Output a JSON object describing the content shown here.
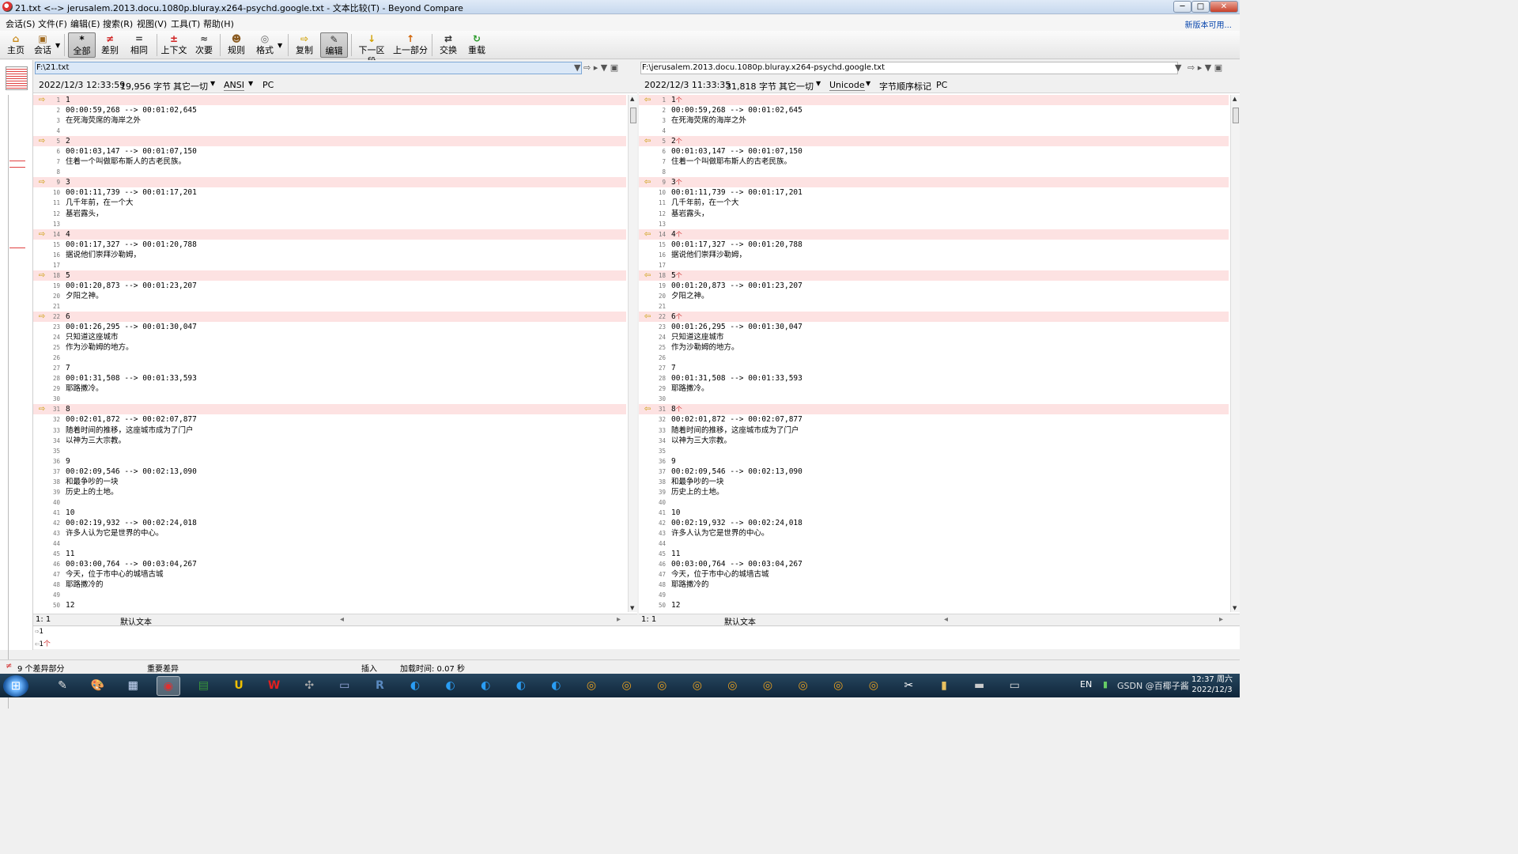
{
  "window": {
    "title": "21.txt <--> jerusalem.2013.docu.1080p.bluray.x264-psychd.google.txt - 文本比较(T) - Beyond Compare",
    "tagline": "",
    "controls": {
      "min": "─",
      "max": "□",
      "close": "✕"
    }
  },
  "menu": {
    "items": [
      "会话(S)",
      "文件(F)",
      "编辑(E)",
      "搜索(R)",
      "视图(V)",
      "工具(T)",
      "帮助(H)"
    ],
    "update_link": "新版本可用..."
  },
  "toolbar": {
    "buttons": [
      {
        "label": "主页",
        "icon": "home-icon",
        "glyph": "⌂",
        "color": "#c98a1a"
      },
      {
        "label": "会话",
        "icon": "session-icon",
        "glyph": "▣",
        "color": "#a06a20"
      },
      {
        "label": "全部",
        "icon": "all-icon",
        "glyph": "*",
        "color": "#222"
      },
      {
        "label": "差别",
        "icon": "diff-icon",
        "glyph": "≠",
        "color": "#d02020"
      },
      {
        "label": "相同",
        "icon": "same-icon",
        "glyph": "=",
        "color": "#444"
      },
      {
        "label": "上下文",
        "icon": "context-icon",
        "glyph": "±",
        "color": "#d02020"
      },
      {
        "label": "次要",
        "icon": "minor-icon",
        "glyph": "≈",
        "color": "#444"
      },
      {
        "label": "规则",
        "icon": "rules-icon",
        "glyph": "☻",
        "color": "#8a5a20"
      },
      {
        "label": "格式",
        "icon": "format-icon",
        "glyph": "◎",
        "color": "#666"
      },
      {
        "label": "复制",
        "icon": "copy-icon",
        "glyph": "⇨",
        "color": "#d0a000"
      },
      {
        "label": "编辑",
        "icon": "edit-icon",
        "glyph": "✎",
        "color": "#333"
      },
      {
        "label": "下一区段",
        "icon": "next-section-icon",
        "glyph": "↓",
        "color": "#d0a000"
      },
      {
        "label": "上一部分",
        "icon": "prev-section-icon",
        "glyph": "↑",
        "color": "#d06000"
      },
      {
        "label": "交换",
        "icon": "swap-icon",
        "glyph": "⇄",
        "color": "#333"
      },
      {
        "label": "重载",
        "icon": "reload-icon",
        "glyph": "↻",
        "color": "#2a9a2a"
      }
    ]
  },
  "left": {
    "path": "F:\\21.txt",
    "date": "2022/12/3 12:33:59",
    "size": "19,956 字节",
    "other": "其它一切",
    "encoding": "ANSI",
    "bom": "",
    "lineend": "PC",
    "pos": "1: 1",
    "mode": "默认文本"
  },
  "right": {
    "path": "F:\\jerusalem.2013.docu.1080p.bluray.x264-psychd.google.txt",
    "date": "2022/12/3 11:33:35",
    "size": "31,818 字节",
    "other": "其它一切",
    "encoding": "Unicode",
    "bom": "字节顺序标记",
    "lineend": "PC",
    "pos": "1: 1",
    "mode": "默认文本"
  },
  "lines": [
    {
      "n": "1",
      "t": "1",
      "d": true
    },
    {
      "n": "2",
      "t": "00:00:59,268 --> 00:01:02,645",
      "d": false
    },
    {
      "n": "3",
      "t": "在死海荧席的海岸之外",
      "d": false
    },
    {
      "n": "4",
      "t": "",
      "d": false
    },
    {
      "n": "5",
      "t": "2",
      "d": true
    },
    {
      "n": "6",
      "t": "00:01:03,147 --> 00:01:07,150",
      "d": false
    },
    {
      "n": "7",
      "t": "住着一个叫做耶布斯人的古老民族。",
      "d": false
    },
    {
      "n": "8",
      "t": "",
      "d": false
    },
    {
      "n": "9",
      "t": "3",
      "d": true
    },
    {
      "n": "10",
      "t": "00:01:11,739 --> 00:01:17,201",
      "d": false
    },
    {
      "n": "11",
      "t": "几千年前，在一个大",
      "d": false
    },
    {
      "n": "12",
      "t": "基岩露头，",
      "d": false
    },
    {
      "n": "13",
      "t": "",
      "d": false
    },
    {
      "n": "14",
      "t": "4",
      "d": true
    },
    {
      "n": "15",
      "t": "00:01:17,327 --> 00:01:20,788",
      "d": false
    },
    {
      "n": "16",
      "t": "据说他们崇拜沙勒姆，",
      "d": false
    },
    {
      "n": "17",
      "t": "",
      "d": false
    },
    {
      "n": "18",
      "t": "5",
      "d": true
    },
    {
      "n": "19",
      "t": "00:01:20,873 --> 00:01:23,207",
      "d": false
    },
    {
      "n": "20",
      "t": "夕阳之神。",
      "d": false
    },
    {
      "n": "21",
      "t": "",
      "d": false
    },
    {
      "n": "22",
      "t": "6",
      "d": true
    },
    {
      "n": "23",
      "t": "00:01:26,295 --> 00:01:30,047",
      "d": false
    },
    {
      "n": "24",
      "t": "只知道这座城市",
      "d": false
    },
    {
      "n": "25",
      "t": "作为沙勒姆的地方。",
      "d": false
    },
    {
      "n": "26",
      "t": "",
      "d": false
    },
    {
      "n": "27",
      "t": "7",
      "d": false
    },
    {
      "n": "28",
      "t": "00:01:31,508 --> 00:01:33,593",
      "d": false
    },
    {
      "n": "29",
      "t": "耶路撒冷。",
      "d": false
    },
    {
      "n": "30",
      "t": "",
      "d": false
    },
    {
      "n": "31",
      "t": "8",
      "d": true
    },
    {
      "n": "32",
      "t": "00:02:01,872 --> 00:02:07,877",
      "d": false
    },
    {
      "n": "33",
      "t": "随着时间的推移，这座城市成为了门户",
      "d": false
    },
    {
      "n": "34",
      "t": "以神为三大宗教。",
      "d": false
    },
    {
      "n": "35",
      "t": "",
      "d": false
    },
    {
      "n": "36",
      "t": "9",
      "d": false
    },
    {
      "n": "37",
      "t": "00:02:09,546 --> 00:02:13,090",
      "d": false
    },
    {
      "n": "38",
      "t": "和最争吵的一块",
      "d": false
    },
    {
      "n": "39",
      "t": "历史上的土地。",
      "d": false
    },
    {
      "n": "40",
      "t": "",
      "d": false
    },
    {
      "n": "41",
      "t": "10",
      "d": false
    },
    {
      "n": "42",
      "t": "00:02:19,932 --> 00:02:24,018",
      "d": false
    },
    {
      "n": "43",
      "t": "许多人认为它是世界的中心。",
      "d": false
    },
    {
      "n": "44",
      "t": "",
      "d": false
    },
    {
      "n": "45",
      "t": "11",
      "d": false
    },
    {
      "n": "46",
      "t": "00:03:00,764 --> 00:03:04,267",
      "d": false
    },
    {
      "n": "47",
      "t": "今天，位于市中心的城墙古城",
      "d": false
    },
    {
      "n": "48",
      "t": "耶路撒冷的",
      "d": false
    },
    {
      "n": "49",
      "t": "",
      "d": false
    },
    {
      "n": "50",
      "t": "12",
      "d": false
    }
  ],
  "diff_marker": "个",
  "compare": {
    "left_line": "1",
    "right_line": "1",
    "right_mark": "个"
  },
  "status": {
    "diff_count": "9 个差异部分",
    "important": "重要差异",
    "insert": "插入",
    "load_time": "加载时间: 0.07 秒"
  },
  "taskbar": {
    "start": "⊞",
    "items": [
      {
        "icon": "pen-icon",
        "glyph": "✎",
        "color": "#e0e0e0"
      },
      {
        "icon": "paint-icon",
        "glyph": "🎨",
        "color": "#f0c060"
      },
      {
        "icon": "calculator-icon",
        "glyph": "▦",
        "color": "#cfe0ff"
      },
      {
        "icon": "beyond-compare-icon",
        "glyph": "◉",
        "color": "#e03030",
        "active": true
      },
      {
        "icon": "table-icon",
        "glyph": "▤",
        "color": "#3a9a3a"
      },
      {
        "icon": "ultraedit-icon",
        "glyph": "U",
        "color": "#f0c000"
      },
      {
        "icon": "wps-icon",
        "glyph": "W",
        "color": "#e02020"
      },
      {
        "icon": "tool-icon",
        "glyph": "✣",
        "color": "#aaa"
      },
      {
        "icon": "notepad-icon",
        "glyph": "▭",
        "color": "#9ad"
      },
      {
        "icon": "r-icon",
        "glyph": "R",
        "color": "#5a8ac0"
      },
      {
        "icon": "edge-icon",
        "glyph": "◐",
        "color": "#2a9df4"
      },
      {
        "icon": "edge-icon",
        "glyph": "◐",
        "color": "#2a9df4"
      },
      {
        "icon": "edge-icon",
        "glyph": "◐",
        "color": "#2a9df4"
      },
      {
        "icon": "edge-icon",
        "glyph": "◐",
        "color": "#2a9df4"
      },
      {
        "icon": "edge-icon",
        "glyph": "◐",
        "color": "#2a9df4"
      },
      {
        "icon": "chrome-icon",
        "glyph": "◎",
        "color": "#e8a020"
      },
      {
        "icon": "chrome-icon",
        "glyph": "◎",
        "color": "#e8a020"
      },
      {
        "icon": "chrome-icon",
        "glyph": "◎",
        "color": "#e8a020"
      },
      {
        "icon": "chrome-icon",
        "glyph": "◎",
        "color": "#e8a020"
      },
      {
        "icon": "chrome-icon",
        "glyph": "◎",
        "color": "#e8a020"
      },
      {
        "icon": "chrome-icon",
        "glyph": "◎",
        "color": "#e8a020"
      },
      {
        "icon": "chrome-icon",
        "glyph": "◎",
        "color": "#e8a020"
      },
      {
        "icon": "chrome-icon",
        "glyph": "◎",
        "color": "#e8a020"
      },
      {
        "icon": "chrome-icon",
        "glyph": "◎",
        "color": "#e8a020"
      },
      {
        "icon": "capcut-icon",
        "glyph": "✂",
        "color": "#fff"
      },
      {
        "icon": "folder-icon",
        "glyph": "▮",
        "color": "#e8c060"
      },
      {
        "icon": "drive-icon",
        "glyph": "▬",
        "color": "#ccc"
      },
      {
        "icon": "terminal-icon",
        "glyph": "▭",
        "color": "#ddd"
      }
    ],
    "lang": "EN",
    "watermark": "GSDN @百椰子酱",
    "clock_time": "12:37 周六",
    "clock_date": "2022/12/3"
  }
}
